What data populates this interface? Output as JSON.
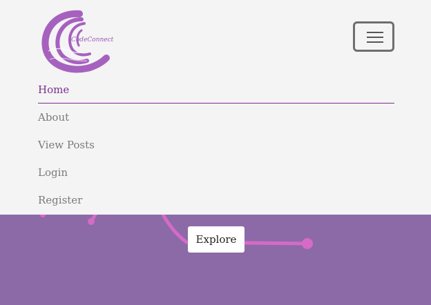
{
  "brand": {
    "logo_text": "CodeConnect",
    "icon": "swirl-logo-icon"
  },
  "navbar": {
    "toggler_icon": "hamburger-menu-icon",
    "items": [
      {
        "label": "Home",
        "active": true
      },
      {
        "label": "About",
        "active": false
      },
      {
        "label": "View Posts",
        "active": false
      },
      {
        "label": "Login",
        "active": false
      },
      {
        "label": "Register",
        "active": false
      }
    ]
  },
  "hero": {
    "button_label": "Explore"
  },
  "colors": {
    "accent": "#7b2d8e",
    "nav_bg": "#f4f4f4",
    "hero_bg": "#8b6aa7",
    "circuit_line": "#d66ac7"
  }
}
